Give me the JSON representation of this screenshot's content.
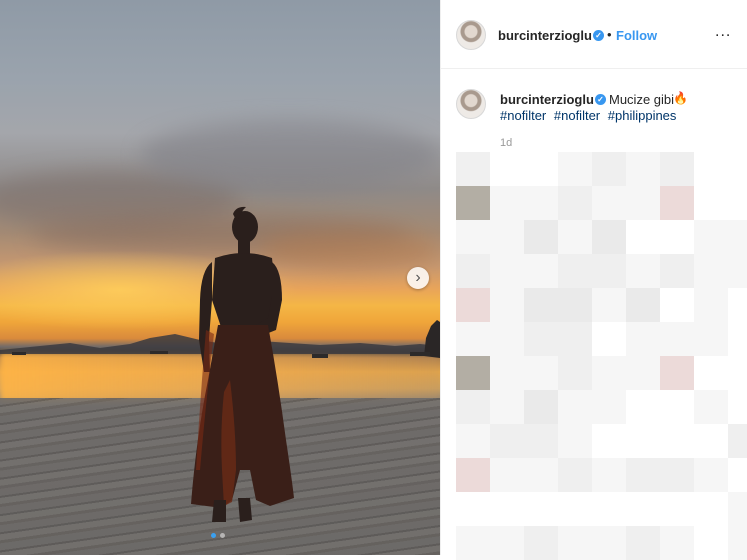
{
  "post": {
    "image_alt": "Silhouette of a woman in a long dress standing on a beach at sunset",
    "carousel": {
      "current": 1,
      "total": 2
    }
  },
  "header": {
    "username": "burcinterzioglu",
    "verified_icon": "verified-badge-icon",
    "separator": "•",
    "follow_label": "Follow",
    "more_icon": "..."
  },
  "caption": {
    "username": "burcinterzioglu",
    "text": "Mucize gibi",
    "emoji": "🔥",
    "hashtags": [
      "#nofilter",
      "#nofilter",
      "#philippines"
    ],
    "time": "1d"
  },
  "colors": {
    "accent": "#3897f0",
    "hashtag": "#003569",
    "text": "#262626",
    "muted": "#999999"
  }
}
